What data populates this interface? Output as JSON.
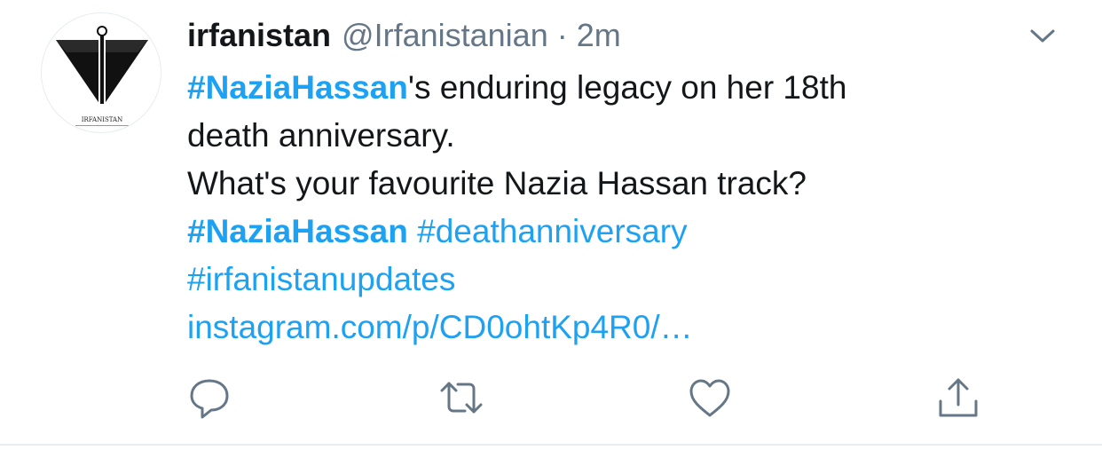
{
  "tweet": {
    "avatar_logo_text": "IRFANISTAN",
    "display_name": "irfanistan",
    "handle": "@Irfanistanian",
    "separator": "·",
    "time": "2m",
    "text": {
      "hashtag1": "#NaziaHassan",
      "line1_rest": "'s enduring legacy on her 18th",
      "line2": "death anniversary.",
      "line3": "What's your favourite Nazia Hassan track?",
      "hashtag2": "#NaziaHassan",
      "hashtag3": "#deathanniversary",
      "hashtag4": "#irfanistanupdates",
      "link": "instagram.com/p/CD0ohtKp4R0/…"
    }
  },
  "colors": {
    "accent": "#1da1f2",
    "muted": "#657786",
    "text": "#14171a",
    "divider": "#e6ecf0"
  },
  "icons": {
    "caret": "chevron-down-icon",
    "reply": "reply-icon",
    "retweet": "retweet-icon",
    "like": "heart-icon",
    "share": "share-icon"
  }
}
